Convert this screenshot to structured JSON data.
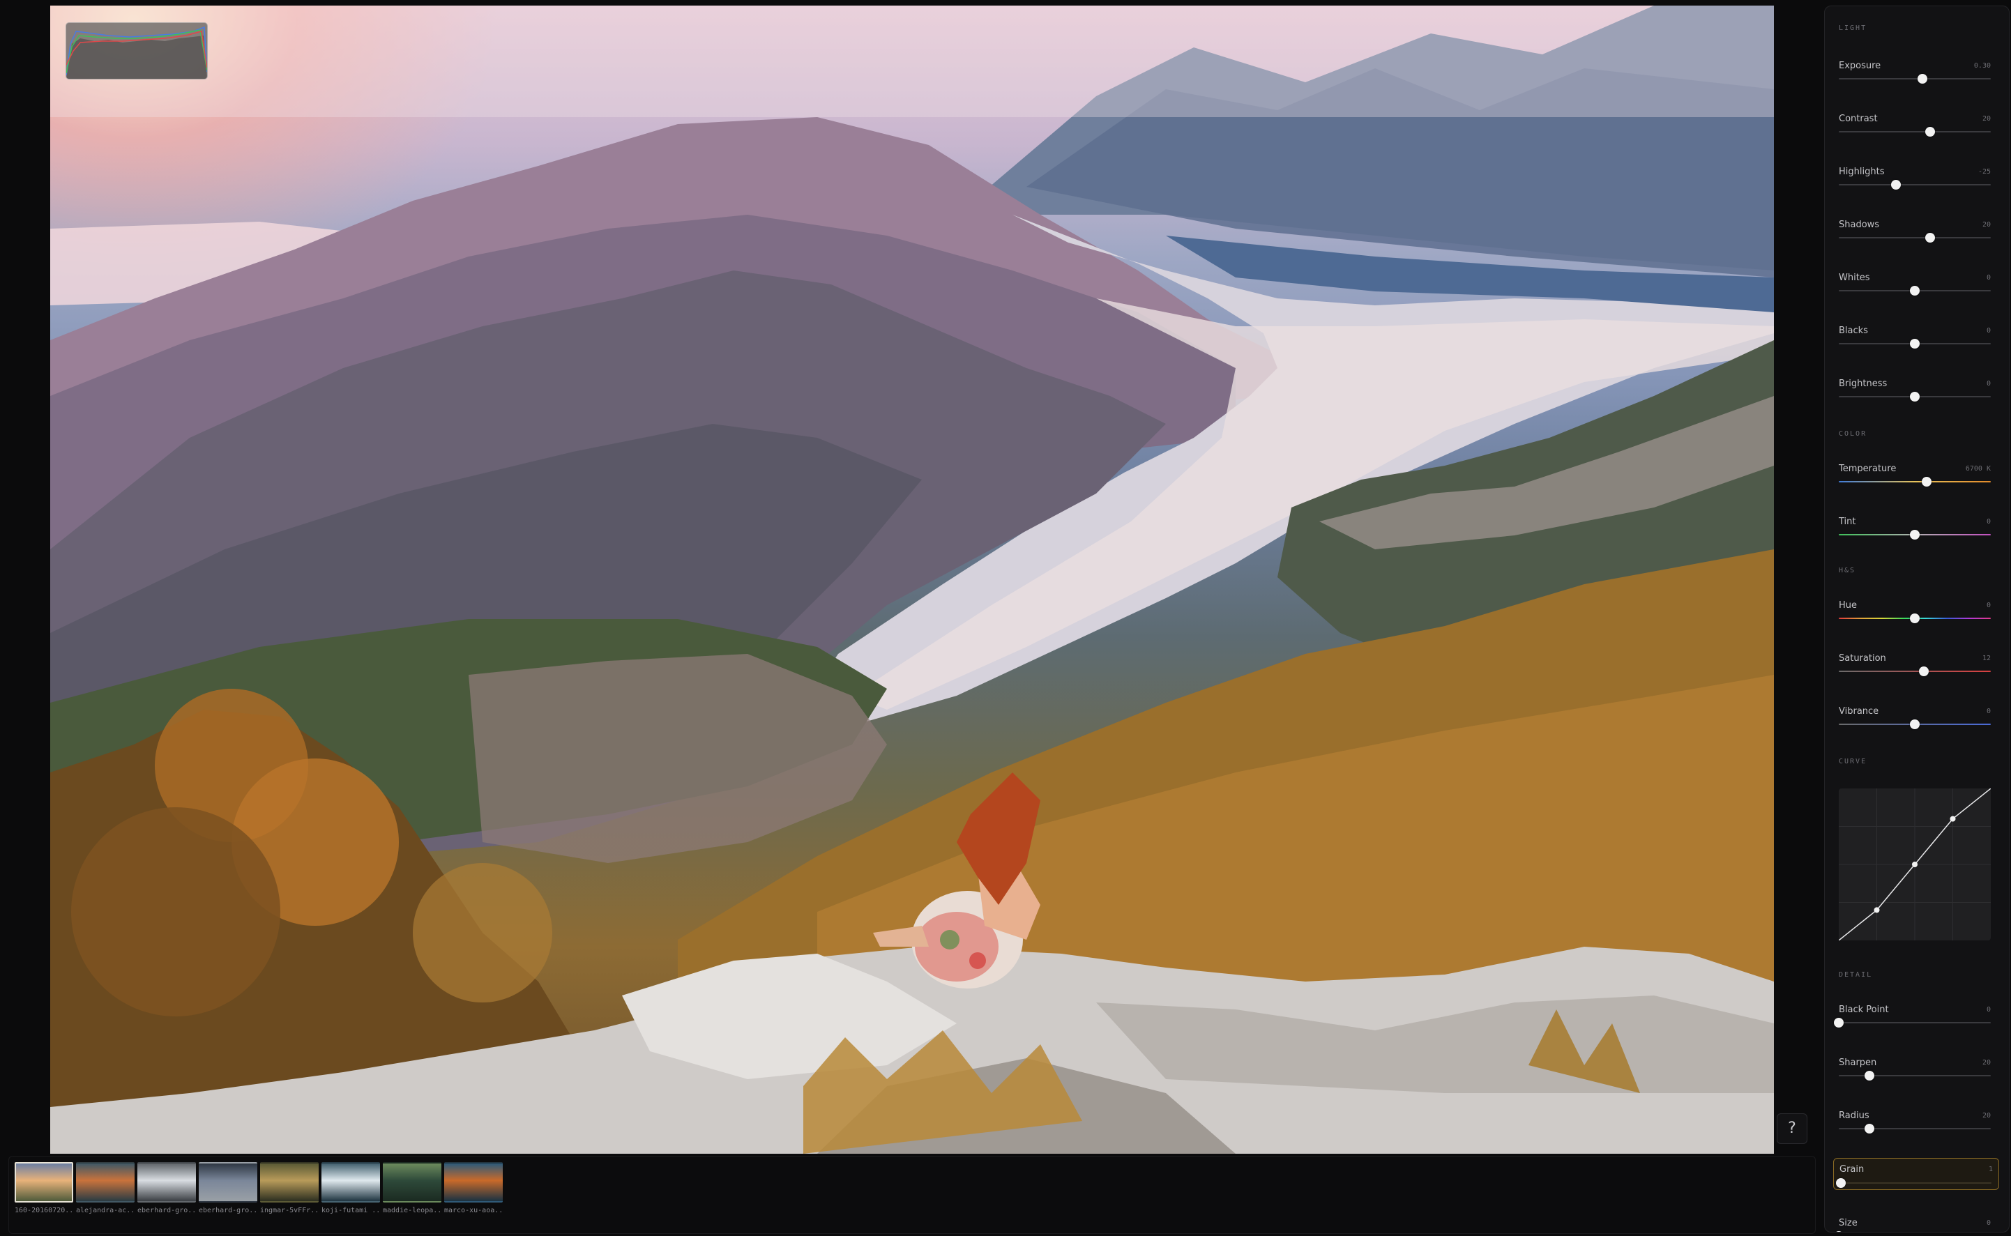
{
  "histogram": {
    "label": ""
  },
  "help": {
    "label": "?"
  },
  "filmstrip": [
    {
      "caption": "160-20160720..",
      "colors": [
        "#e8b27a",
        "#6b7fa3",
        "#4f5b3b"
      ],
      "active": true
    },
    {
      "caption": "alejandra-ac..",
      "colors": [
        "#c9733c",
        "#3f5866",
        "#2a3b43"
      ],
      "active": false
    },
    {
      "caption": "eberhard-gro..",
      "colors": [
        "#d9dde2",
        "#60656a",
        "#3b3f44"
      ],
      "active": false
    },
    {
      "caption": "eberhard-gro..",
      "colors": [
        "#7a8699",
        "#2e3743",
        "#9aa0a6"
      ],
      "active": false
    },
    {
      "caption": "ingmar-5vFFr..",
      "colors": [
        "#b89b5a",
        "#5a5a35",
        "#2d2f20"
      ],
      "active": false
    },
    {
      "caption": "koji-futami ..",
      "colors": [
        "#dfe9ee",
        "#43606e",
        "#1e3440"
      ],
      "active": false
    },
    {
      "caption": "maddie-leopa..",
      "colors": [
        "#2e4a3a",
        "#6c8a5d",
        "#1b2a21"
      ],
      "active": false
    },
    {
      "caption": "marco-xu-aoa..",
      "colors": [
        "#c96a2a",
        "#2c5a7a",
        "#193242"
      ],
      "active": false
    }
  ],
  "panel": {
    "sections": {
      "light": "LIGHT",
      "color": "COLOR",
      "hsl": "H&S",
      "curve": "CURVE",
      "detail": "DETAIL"
    },
    "controls": {
      "exposure": {
        "label": "Exposure",
        "value": "0.30",
        "level": 0.55
      },
      "contrast": {
        "label": "Contrast",
        "value": "20",
        "level": 0.6
      },
      "highlights": {
        "label": "Highlights",
        "value": "-25",
        "level": 0.375
      },
      "shadows": {
        "label": "Shadows",
        "value": "20",
        "level": 0.6
      },
      "whites": {
        "label": "Whites",
        "value": "0",
        "level": 0.5
      },
      "blacks": {
        "label": "Blacks",
        "value": "0",
        "level": 0.5
      },
      "brightness": {
        "label": "Brightness",
        "value": "0",
        "level": 0.5
      },
      "temperature": {
        "label": "Temperature",
        "value": "6700 K",
        "level": 0.58
      },
      "tint": {
        "label": "Tint",
        "value": "0",
        "level": 0.5
      },
      "hue": {
        "label": "Hue",
        "value": "0",
        "level": 0.5
      },
      "saturation": {
        "label": "Saturation",
        "value": "12",
        "level": 0.56
      },
      "vibrance": {
        "label": "Vibrance",
        "value": "0",
        "level": 0.5
      },
      "blackpoint": {
        "label": "Black Point",
        "value": "0",
        "level": 0.0
      },
      "sharpen": {
        "label": "Sharpen",
        "value": "20",
        "level": 0.2
      },
      "radius": {
        "label": "Radius",
        "value": "20",
        "level": 0.2
      },
      "grain": {
        "label": "Grain",
        "value": "1",
        "level": 0.01
      },
      "size": {
        "label": "Size",
        "value": "0",
        "level": 0.0
      }
    },
    "curve_points": [
      [
        0,
        0
      ],
      [
        0.25,
        0.2
      ],
      [
        0.5,
        0.5
      ],
      [
        0.75,
        0.8
      ],
      [
        1,
        1
      ]
    ]
  },
  "colors": {
    "accent": "#8a6a24",
    "panel_bg": "#121214",
    "knob": "#f2f2f2"
  }
}
